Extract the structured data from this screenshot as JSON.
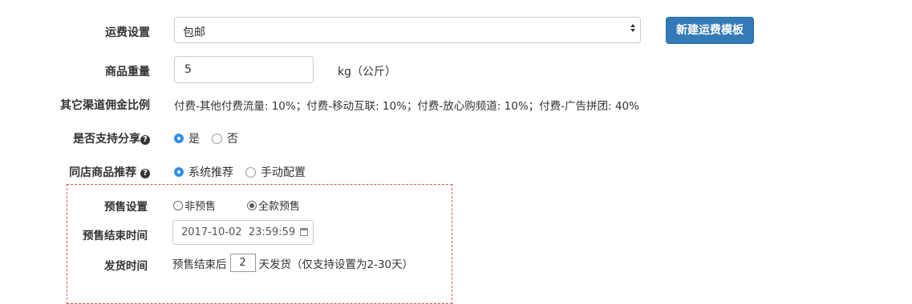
{
  "shipping": {
    "label": "运费设置",
    "selected": "包邮",
    "new_template_button": "新建运费模板"
  },
  "weight": {
    "label": "商品重量",
    "value": "5",
    "unit": "kg（公斤）"
  },
  "commission": {
    "label": "其它渠道佣金比例",
    "text": "付费-其他付费流量: 10%；付费-移动互联: 10%；付费-放心购频道: 10%；付费-广告拼团: 40%"
  },
  "share": {
    "label": "是否支持分享",
    "help": "?",
    "options": [
      "是",
      "否"
    ],
    "selected": "是"
  },
  "recommend": {
    "label": "同店商品推荐",
    "help": "?",
    "options": [
      "系统推荐",
      "手动配置"
    ],
    "selected": "系统推荐"
  },
  "presale": {
    "label": "预售设置",
    "options": [
      "非预售",
      "全款预售"
    ],
    "selected": "全款预售",
    "end_label": "预售结束时间",
    "end_value": "2017-10-02  23:59:59",
    "ship_label": "发货时间",
    "ship_prefix": "预售结束后",
    "ship_days": "2",
    "ship_suffix": "天发货（仅支持设置为2-30天）"
  },
  "colors": {
    "primary": "#337ab7",
    "radio": "#2f8de4",
    "dashed_border": "#d9534f"
  }
}
